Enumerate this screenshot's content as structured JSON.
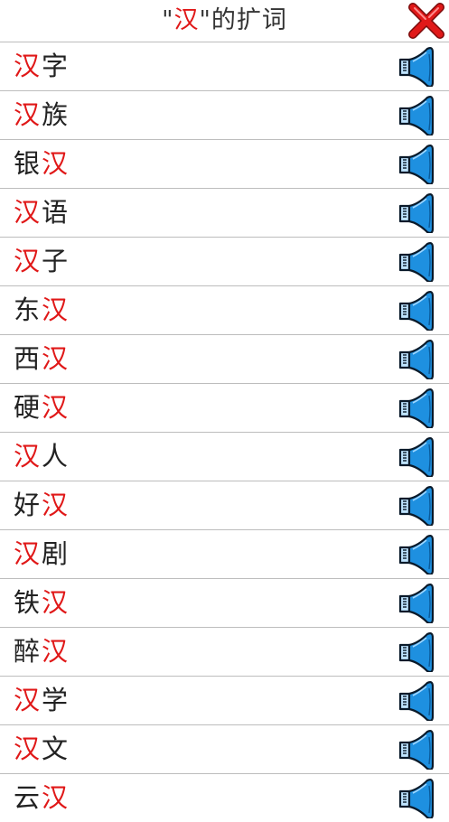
{
  "header": {
    "title_prefix": "\"",
    "title_char": "汉",
    "title_suffix": "\"的扩词",
    "close_icon": "close-x-icon"
  },
  "colors": {
    "highlight": "#e01818",
    "text": "#222222",
    "divider": "#bdbdbd",
    "close": "#e01818",
    "speaker": "#1e90e0"
  },
  "words": [
    {
      "pre": "",
      "hl": "汉",
      "post": "字"
    },
    {
      "pre": "",
      "hl": "汉",
      "post": "族"
    },
    {
      "pre": "银",
      "hl": "汉",
      "post": ""
    },
    {
      "pre": "",
      "hl": "汉",
      "post": "语"
    },
    {
      "pre": "",
      "hl": "汉",
      "post": "子"
    },
    {
      "pre": "东",
      "hl": "汉",
      "post": ""
    },
    {
      "pre": "西",
      "hl": "汉",
      "post": ""
    },
    {
      "pre": "硬",
      "hl": "汉",
      "post": ""
    },
    {
      "pre": "",
      "hl": "汉",
      "post": "人"
    },
    {
      "pre": "好",
      "hl": "汉",
      "post": ""
    },
    {
      "pre": "",
      "hl": "汉",
      "post": "剧"
    },
    {
      "pre": "铁",
      "hl": "汉",
      "post": ""
    },
    {
      "pre": "醉",
      "hl": "汉",
      "post": ""
    },
    {
      "pre": "",
      "hl": "汉",
      "post": "学"
    },
    {
      "pre": "",
      "hl": "汉",
      "post": "文"
    },
    {
      "pre": "云",
      "hl": "汉",
      "post": ""
    }
  ],
  "speaker_icon": "speaker-icon"
}
